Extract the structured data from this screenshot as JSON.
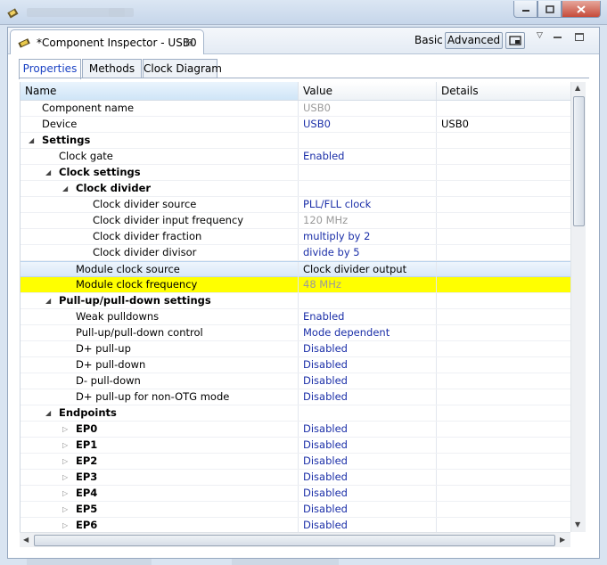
{
  "view": {
    "tab_title": "*Component Inspector - USB0",
    "close_glyph": "⊠",
    "mode_basic": "Basic",
    "mode_advanced": "Advanced"
  },
  "inner_tabs": [
    {
      "label": "Properties",
      "active": true
    },
    {
      "label": "Methods",
      "active": false
    },
    {
      "label": "Clock Diagram",
      "active": false
    }
  ],
  "table": {
    "headers": {
      "name": "Name",
      "value": "Value",
      "details": "Details"
    },
    "rows": [
      {
        "name": "Component name",
        "value": "USB0",
        "details": "",
        "indent": 0,
        "toggle": "none",
        "bold": false,
        "value_color": "gray"
      },
      {
        "name": "Device",
        "value": "USB0",
        "details": "USB0",
        "indent": 0,
        "toggle": "none",
        "bold": false,
        "value_color": "blue"
      },
      {
        "name": "Settings",
        "value": "",
        "details": "",
        "indent": 0,
        "toggle": "expanded",
        "bold": true,
        "value_color": "blue"
      },
      {
        "name": "Clock gate",
        "value": "Enabled",
        "details": "",
        "indent": 1,
        "toggle": "none",
        "bold": false,
        "value_color": "blue"
      },
      {
        "name": "Clock settings",
        "value": "",
        "details": "",
        "indent": 1,
        "toggle": "expanded",
        "bold": true,
        "value_color": "blue"
      },
      {
        "name": "Clock divider",
        "value": "",
        "details": "",
        "indent": 2,
        "toggle": "expanded",
        "bold": true,
        "value_color": "blue"
      },
      {
        "name": "Clock divider source",
        "value": "PLL/FLL clock",
        "details": "",
        "indent": 3,
        "toggle": "none",
        "bold": false,
        "value_color": "blue"
      },
      {
        "name": "Clock divider input frequency",
        "value": "120 MHz",
        "details": "",
        "indent": 3,
        "toggle": "none",
        "bold": false,
        "value_color": "gray"
      },
      {
        "name": "Clock divider fraction",
        "value": "multiply by 2",
        "details": "",
        "indent": 3,
        "toggle": "none",
        "bold": false,
        "value_color": "blue"
      },
      {
        "name": "Clock divider divisor",
        "value": "divide by 5",
        "details": "",
        "indent": 3,
        "toggle": "none",
        "bold": false,
        "value_color": "blue"
      },
      {
        "name": "Module clock source",
        "value": "Clock divider output",
        "details": "",
        "indent": 2,
        "toggle": "none",
        "bold": false,
        "value_color": "black",
        "state": "selected"
      },
      {
        "name": "Module clock frequency",
        "value": "48 MHz",
        "details": "",
        "indent": 2,
        "toggle": "none",
        "bold": false,
        "value_color": "gray",
        "state": "highlight"
      },
      {
        "name": "Pull-up/pull-down settings",
        "value": "",
        "details": "",
        "indent": 1,
        "toggle": "expanded",
        "bold": true,
        "value_color": "blue"
      },
      {
        "name": "Weak pulldowns",
        "value": "Enabled",
        "details": "",
        "indent": 2,
        "toggle": "none",
        "bold": false,
        "value_color": "blue"
      },
      {
        "name": "Pull-up/pull-down control",
        "value": "Mode dependent",
        "details": "",
        "indent": 2,
        "toggle": "none",
        "bold": false,
        "value_color": "blue"
      },
      {
        "name": "D+ pull-up",
        "value": "Disabled",
        "details": "",
        "indent": 2,
        "toggle": "none",
        "bold": false,
        "value_color": "blue"
      },
      {
        "name": "D+ pull-down",
        "value": "Disabled",
        "details": "",
        "indent": 2,
        "toggle": "none",
        "bold": false,
        "value_color": "blue"
      },
      {
        "name": "D- pull-down",
        "value": "Disabled",
        "details": "",
        "indent": 2,
        "toggle": "none",
        "bold": false,
        "value_color": "blue"
      },
      {
        "name": "D+ pull-up for non-OTG mode",
        "value": "Disabled",
        "details": "",
        "indent": 2,
        "toggle": "none",
        "bold": false,
        "value_color": "blue"
      },
      {
        "name": "Endpoints",
        "value": "",
        "details": "",
        "indent": 1,
        "toggle": "expanded",
        "bold": true,
        "value_color": "blue"
      },
      {
        "name": "EP0",
        "value": "Disabled",
        "details": "",
        "indent": 2,
        "toggle": "collapsed",
        "bold": true,
        "value_color": "blue"
      },
      {
        "name": "EP1",
        "value": "Disabled",
        "details": "",
        "indent": 2,
        "toggle": "collapsed",
        "bold": true,
        "value_color": "blue"
      },
      {
        "name": "EP2",
        "value": "Disabled",
        "details": "",
        "indent": 2,
        "toggle": "collapsed",
        "bold": true,
        "value_color": "blue"
      },
      {
        "name": "EP3",
        "value": "Disabled",
        "details": "",
        "indent": 2,
        "toggle": "collapsed",
        "bold": true,
        "value_color": "blue"
      },
      {
        "name": "EP4",
        "value": "Disabled",
        "details": "",
        "indent": 2,
        "toggle": "collapsed",
        "bold": true,
        "value_color": "blue"
      },
      {
        "name": "EP5",
        "value": "Disabled",
        "details": "",
        "indent": 2,
        "toggle": "collapsed",
        "bold": true,
        "value_color": "blue"
      },
      {
        "name": "EP6",
        "value": "Disabled",
        "details": "",
        "indent": 2,
        "toggle": "collapsed",
        "bold": true,
        "value_color": "blue"
      }
    ]
  },
  "colors": {
    "value_blue": "#1b2fa8",
    "value_gray": "#9a9a9a",
    "highlight": "#ffff00",
    "tab_active_text": "#1c43c4"
  }
}
